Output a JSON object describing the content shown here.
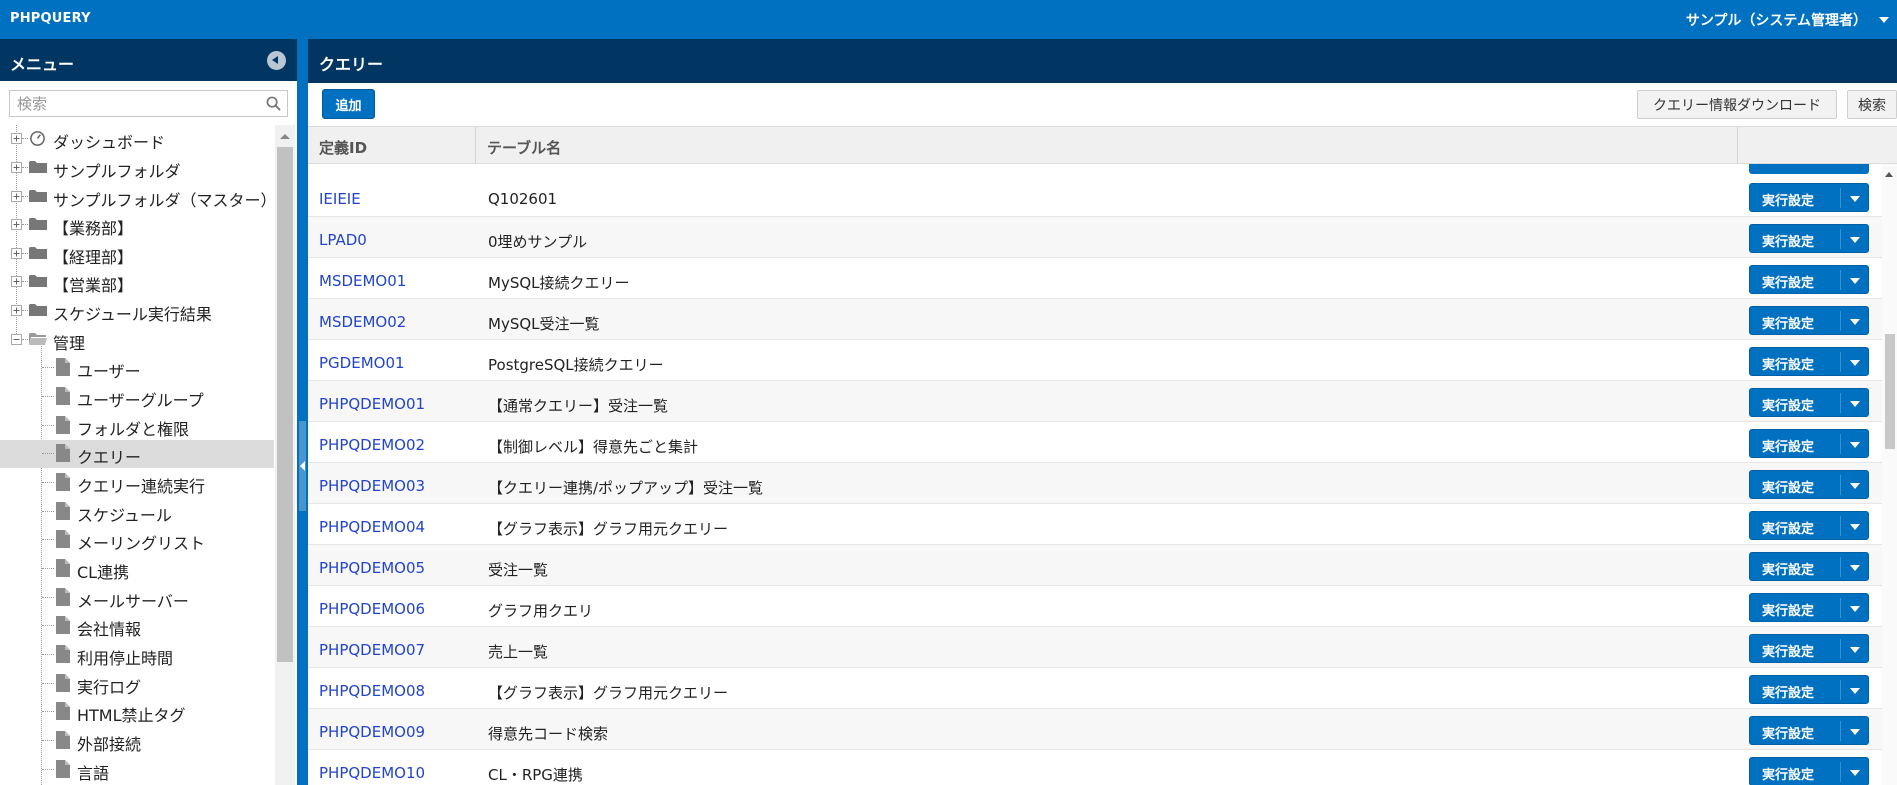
{
  "app": {
    "brand": "PHPQUERY",
    "user": "サンプル（システム管理者）"
  },
  "sidebar": {
    "title": "メニュー",
    "search_placeholder": "検索",
    "items": [
      {
        "label": "ダッシュボード",
        "icon": "gauge-icon"
      },
      {
        "label": "サンプルフォルダ",
        "icon": "folder-icon"
      },
      {
        "label": "サンプルフォルダ（マスター）",
        "icon": "folder-icon"
      },
      {
        "label": "【業務部】",
        "icon": "folder-icon"
      },
      {
        "label": "【経理部】",
        "icon": "folder-icon"
      },
      {
        "label": "【営業部】",
        "icon": "folder-icon"
      },
      {
        "label": "スケジュール実行結果",
        "icon": "folder-icon"
      },
      {
        "label": "管理",
        "icon": "folder-open-icon"
      }
    ],
    "admin_items": [
      {
        "label": "ユーザー"
      },
      {
        "label": "ユーザーグループ"
      },
      {
        "label": "フォルダと権限"
      },
      {
        "label": "クエリー",
        "selected": true
      },
      {
        "label": "クエリー連続実行"
      },
      {
        "label": "スケジュール"
      },
      {
        "label": "メーリングリスト"
      },
      {
        "label": "CL連携"
      },
      {
        "label": "メールサーバー"
      },
      {
        "label": "会社情報"
      },
      {
        "label": "利用停止時間"
      },
      {
        "label": "実行ログ"
      },
      {
        "label": "HTML禁止タグ"
      },
      {
        "label": "外部接続"
      },
      {
        "label": "言語"
      }
    ]
  },
  "main": {
    "title": "クエリー",
    "toolbar": {
      "add_label": "追加",
      "download_label": "クエリー情報ダウンロード",
      "search_label": "検索"
    },
    "columns": {
      "id": "定義ID",
      "table": "テーブル名"
    },
    "run_label": "実行設定",
    "rows": [
      {
        "id": "IEIEIE",
        "name": "Q102601"
      },
      {
        "id": "LPAD0",
        "name": "0埋めサンプル"
      },
      {
        "id": "MSDEMO01",
        "name": "MySQL接続クエリー"
      },
      {
        "id": "MSDEMO02",
        "name": "MySQL受注一覧"
      },
      {
        "id": "PGDEMO01",
        "name": "PostgreSQL接続クエリー"
      },
      {
        "id": "PHPQDEMO01",
        "name": "【通常クエリー】受注一覧"
      },
      {
        "id": "PHPQDEMO02",
        "name": "【制御レベル】得意先ごと集計"
      },
      {
        "id": "PHPQDEMO03",
        "name": "【クエリー連携/ポップアップ】受注一覧"
      },
      {
        "id": "PHPQDEMO04",
        "name": "【グラフ表示】グラフ用元クエリー"
      },
      {
        "id": "PHPQDEMO05",
        "name": "受注一覧"
      },
      {
        "id": "PHPQDEMO06",
        "name": "グラフ用クエリ"
      },
      {
        "id": "PHPQDEMO07",
        "name": "売上一覧"
      },
      {
        "id": "PHPQDEMO08",
        "name": "【グラフ表示】グラフ用元クエリー"
      },
      {
        "id": "PHPQDEMO09",
        "name": "得意先コード検索"
      },
      {
        "id": "PHPQDEMO10",
        "name": "CL・RPG連携"
      }
    ]
  },
  "colors": {
    "topbar": "#0070c0",
    "header": "#003661",
    "link": "#2244cc",
    "button": "#0070c0"
  }
}
